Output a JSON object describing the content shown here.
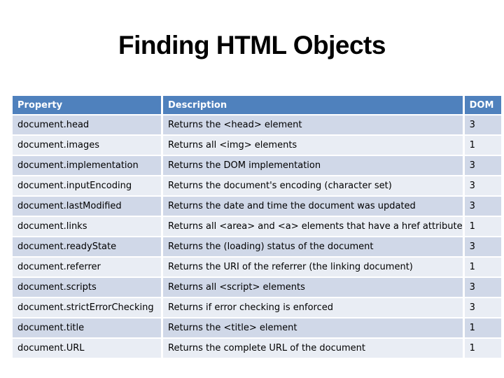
{
  "title": "Finding HTML Objects",
  "table": {
    "headers": [
      "Property",
      "Description",
      "DOM"
    ],
    "rows": [
      {
        "property": "document.head",
        "description": "Returns the <head> element",
        "dom": "3"
      },
      {
        "property": "document.images",
        "description": "Returns all <img> elements",
        "dom": "1"
      },
      {
        "property": "document.implementation",
        "description": "Returns the DOM implementation",
        "dom": "3"
      },
      {
        "property": "document.inputEncoding",
        "description": "Returns the document's encoding (character set)",
        "dom": "3"
      },
      {
        "property": "document.lastModified",
        "description": "Returns the date and time the document was updated",
        "dom": "3"
      },
      {
        "property": "document.links",
        "description": "Returns all <area> and <a> elements that have a href attribute",
        "dom": "1"
      },
      {
        "property": "document.readyState",
        "description": "Returns the (loading) status of the document",
        "dom": "3"
      },
      {
        "property": "document.referrer",
        "description": "Returns the URI of the referrer (the linking document)",
        "dom": "1"
      },
      {
        "property": "document.scripts",
        "description": "Returns all <script> elements",
        "dom": "3"
      },
      {
        "property": "document.strictErrorChecking",
        "description": "Returns if error checking is enforced",
        "dom": "3"
      },
      {
        "property": "document.title",
        "description": "Returns the <title> element",
        "dom": "1"
      },
      {
        "property": "document.URL",
        "description": "Returns the complete URL of the document",
        "dom": "1"
      }
    ]
  }
}
